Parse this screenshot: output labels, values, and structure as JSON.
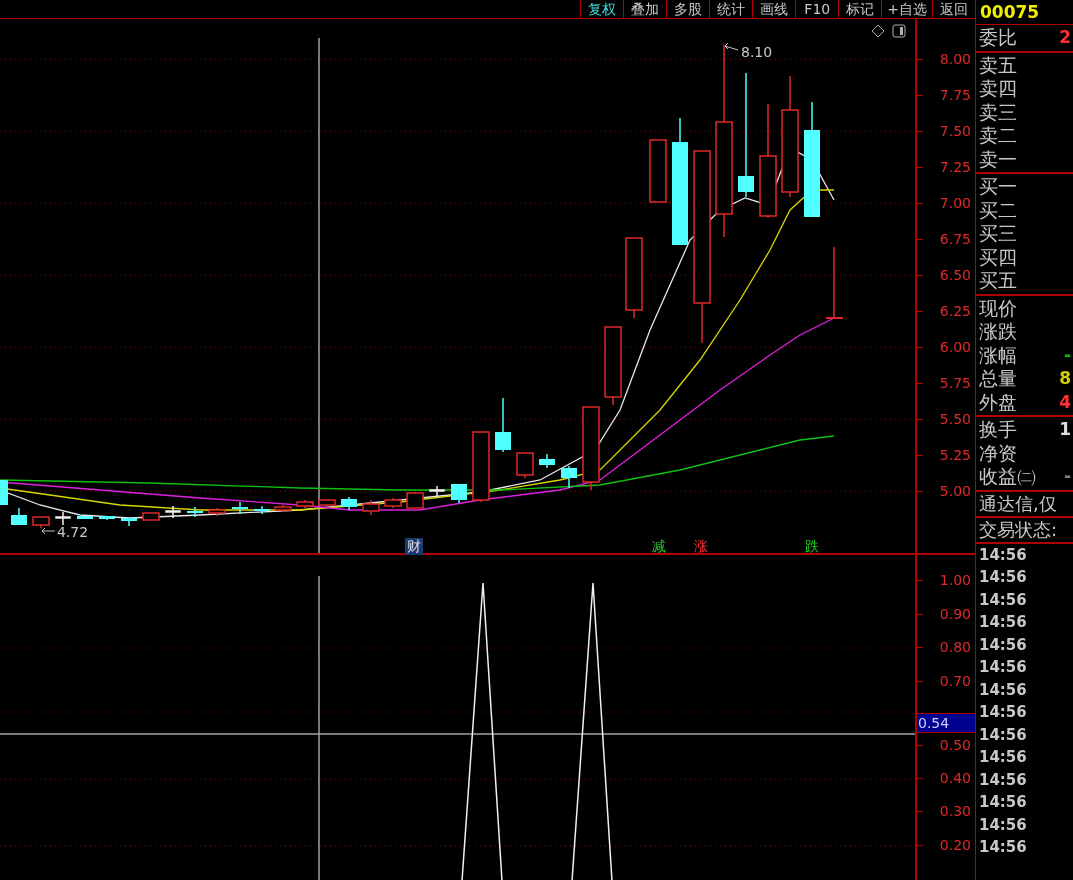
{
  "toolbar": {
    "tabs": [
      {
        "label": "复权",
        "selected": true
      },
      {
        "label": "叠加",
        "selected": false
      },
      {
        "label": "多股",
        "selected": false
      },
      {
        "label": "统计",
        "selected": false
      },
      {
        "label": "画线",
        "selected": false
      },
      {
        "label": "F10",
        "selected": false
      },
      {
        "label": "标记",
        "selected": false
      },
      {
        "label": "+自选",
        "selected": false
      },
      {
        "label": "返回",
        "selected": false
      }
    ]
  },
  "stock_code": "00075",
  "order_book": {
    "ratio": {
      "label": "委比",
      "value": "2",
      "color": "#ff3030"
    },
    "asks": [
      "卖五",
      "卖四",
      "卖三",
      "卖二",
      "卖一"
    ],
    "bids": [
      "买一",
      "买二",
      "买三",
      "买四",
      "买五"
    ]
  },
  "quote": [
    {
      "label": "现价"
    },
    {
      "label": "涨跌"
    },
    {
      "label": "涨幅",
      "value": "-",
      "color": "#00c000"
    },
    {
      "label": "总量",
      "value": "8",
      "color": "#d0d000"
    },
    {
      "label": "外盘",
      "value": "4",
      "color": "#ff3030"
    }
  ],
  "info": [
    {
      "label": "换手",
      "value": "1",
      "color": "#e0e0e0"
    },
    {
      "label": "净资"
    },
    {
      "label": "收益㈡",
      "value": "-",
      "color": "#808080"
    }
  ],
  "notice": "通达信,仅",
  "trade_status": "交易状态:",
  "ticks": [
    "14:56",
    "14:56",
    "14:56",
    "14:56",
    "14:56",
    "14:56",
    "14:56",
    "14:56",
    "14:56",
    "14:56",
    "14:56",
    "14:56",
    "14:56",
    "14:56"
  ],
  "price_chart": {
    "y_labels": [
      "8.00",
      "7.75",
      "7.50",
      "7.25",
      "7.00",
      "6.75",
      "6.50",
      "6.25",
      "6.00",
      "5.75",
      "5.50",
      "5.25",
      "5.00"
    ],
    "high_label": "8.10",
    "low_label": "4.72",
    "markers": [
      {
        "text": "财",
        "kind": "info"
      },
      {
        "text": "减",
        "kind": "down"
      },
      {
        "text": "涨",
        "kind": "up"
      },
      {
        "text": "跌",
        "kind": "down"
      }
    ]
  },
  "indicator_chart": {
    "y_labels": [
      "1.00",
      "0.90",
      "0.80",
      "0.70",
      "0.50",
      "0.40",
      "0.30",
      "0.20"
    ],
    "cursor_value": "0.54"
  }
}
